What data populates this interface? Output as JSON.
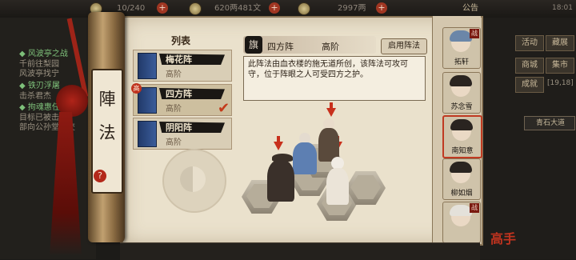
{
  "topbar": {
    "stamina": "10/240",
    "silver": "620两481文",
    "gold": "2997两",
    "notice_label": "公告",
    "time": "18:01"
  },
  "quests": [
    {
      "title": "◆ 风波亭之战",
      "lines": [
        "千前往梨园",
        "风波亭找宁"
      ]
    },
    {
      "title": "◆ 铁刃浮屠",
      "lines": [
        "击杀君杰"
      ]
    },
    {
      "title": "◆ 拘魂惠任务",
      "lines": [
        "目标已被击杀",
        "部向公孙堂主交"
      ]
    }
  ],
  "side_buttons": [
    "活动",
    "藏展",
    "商城",
    "集市",
    "成就"
  ],
  "side_extra": "[19,18]",
  "right_notice": "青石大道",
  "scroll": {
    "chars": [
      "陣",
      "法"
    ],
    "help": "?"
  },
  "list": {
    "title": "列表",
    "items": [
      {
        "name": "梅花阵",
        "rank": "高阶"
      },
      {
        "name": "四方阵",
        "rank": "高阶",
        "badge": "高"
      },
      {
        "name": "阴阳阵",
        "rank": "高阶"
      }
    ]
  },
  "detail": {
    "flag": "旗",
    "name": "四方阵",
    "rank": "高阶",
    "use_button": "启用阵法",
    "description": "此阵法由血衣楼的施无道所创，该阵法可攻可守，位于阵眼之人可受四方之护。"
  },
  "party": [
    {
      "name": "拓轩",
      "tag": "战"
    },
    {
      "name": "苏念雪"
    },
    {
      "name": "南知意"
    },
    {
      "name": "柳如烟"
    },
    {
      "name": "",
      "tag": "战"
    }
  ],
  "seal": "高手"
}
